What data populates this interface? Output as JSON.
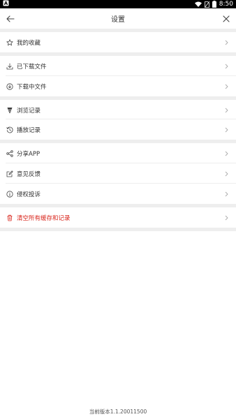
{
  "status_bar": {
    "time": "8:50"
  },
  "header": {
    "title": "设置",
    "back_icon": "arrow-left-icon",
    "close_icon": "close-icon"
  },
  "groups": [
    {
      "items": [
        {
          "label": "我的收藏",
          "icon": "star-icon"
        }
      ]
    },
    {
      "items": [
        {
          "label": "已下载文件",
          "icon": "download-icon"
        },
        {
          "label": "下载中文件",
          "icon": "downloading-icon"
        }
      ]
    },
    {
      "items": [
        {
          "label": "浏览记录",
          "icon": "browse-icon"
        },
        {
          "label": "播放记录",
          "icon": "history-icon"
        }
      ]
    },
    {
      "items": [
        {
          "label": "分享APP",
          "icon": "share-icon"
        },
        {
          "label": "意见反馈",
          "icon": "feedback-icon"
        },
        {
          "label": "侵权投诉",
          "icon": "info-icon"
        }
      ]
    },
    {
      "items": [
        {
          "label": "清空所有缓存和记录",
          "icon": "trash-icon"
        }
      ]
    }
  ],
  "footer": {
    "version_text": "当前版本1.1.20011500"
  },
  "colors": {
    "danger": "#d9261c",
    "separator": "#eeeeee",
    "text": "#333333"
  }
}
